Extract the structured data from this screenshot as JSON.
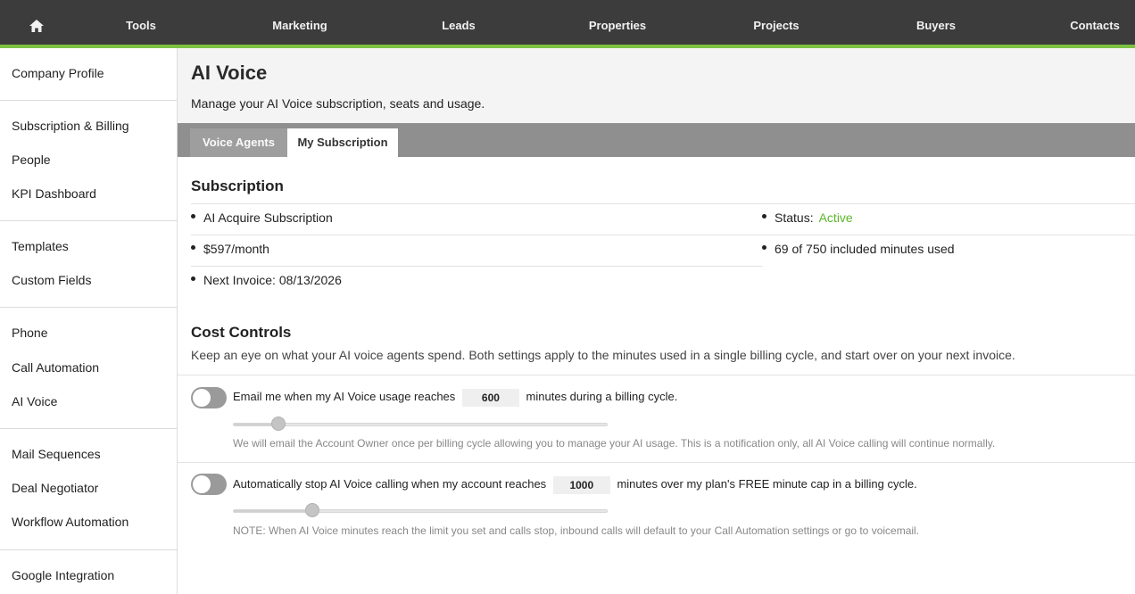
{
  "topnav": {
    "home_icon": "home-icon",
    "items": [
      "Tools",
      "Marketing",
      "Leads",
      "Properties",
      "Projects",
      "Buyers",
      "Contacts"
    ],
    "accent_color": "#7cc242"
  },
  "sidebar": {
    "items": [
      "Company Profile",
      "Subscription & Billing",
      "People",
      "KPI Dashboard",
      "Templates",
      "Custom Fields",
      "Phone",
      "Call Automation",
      "AI Voice",
      "Mail Sequences",
      "Deal Negotiator",
      "Workflow Automation",
      "Google Integration"
    ]
  },
  "page": {
    "title": "AI Voice",
    "subtitle": "Manage your AI Voice subscription, seats and usage."
  },
  "tabs": [
    {
      "label": "Voice Agents",
      "active": false
    },
    {
      "label": "My Subscription",
      "active": true
    }
  ],
  "subscription": {
    "title": "Subscription",
    "plan": "AI Acquire Subscription",
    "price": "$597/month",
    "next_invoice": "Next Invoice: 08/13/2026",
    "status_label": "Status:",
    "status_value": "Active",
    "status_color": "#5cb62a",
    "minutes_used": "69 of 750 included minutes used"
  },
  "cost_controls": {
    "title": "Cost Controls",
    "description": "Keep an eye on what your AI voice agents spend. Both settings apply to the minutes used in a single billing cycle, and start over on your next invoice.",
    "email_alert": {
      "enabled": false,
      "prefix": "Email me when my AI Voice usage reaches",
      "value": "600",
      "suffix": "minutes during a billing cycle.",
      "slider_fraction": 0.12,
      "note": "We will email the Account Owner once per billing cycle allowing you to manage your AI usage. This is a notification only, all AI Voice calling will continue normally."
    },
    "auto_stop": {
      "enabled": false,
      "prefix": "Automatically stop AI Voice calling when my account reaches",
      "value": "1000",
      "suffix": "minutes over my plan's FREE minute cap in a billing cycle.",
      "slider_fraction": 0.21,
      "note": "NOTE: When AI Voice minutes reach the limit you set and calls stop, inbound calls will default to your Call Automation settings or go to voicemail."
    }
  }
}
